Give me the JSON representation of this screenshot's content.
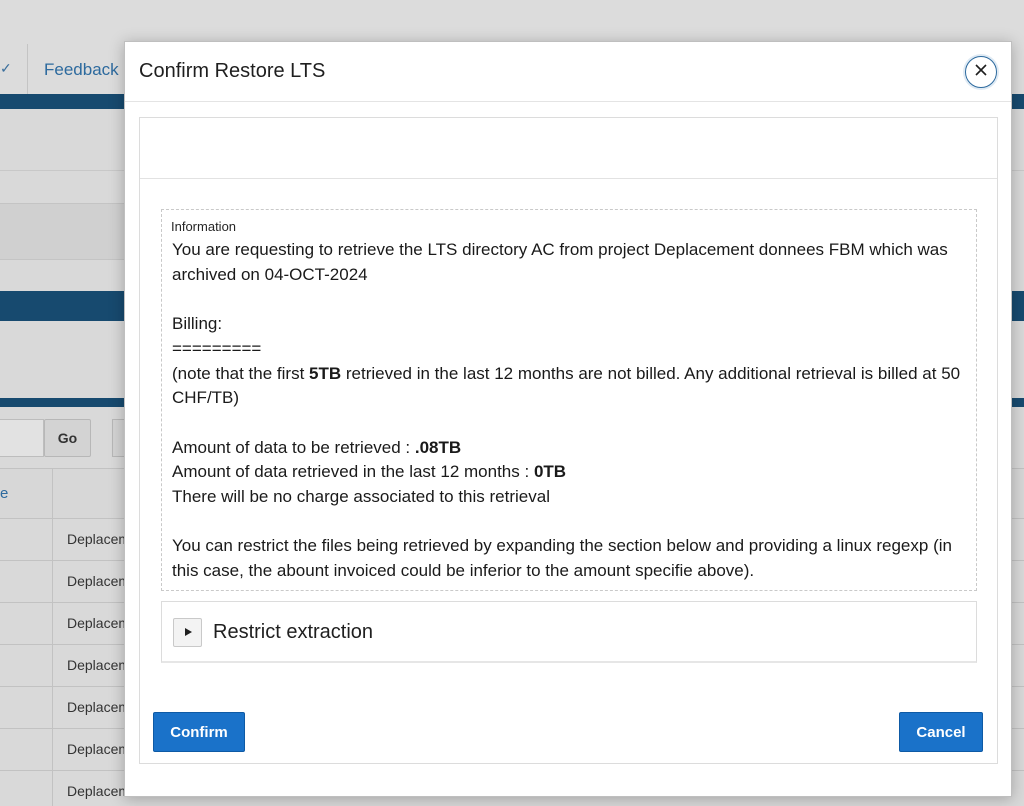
{
  "background": {
    "nav": {
      "feedback_label": "Feedback"
    },
    "search": {
      "go_label": "Go"
    },
    "table": {
      "header_first_col": "e",
      "rows": [
        "Deplacem",
        "Deplacem",
        "Deplacem",
        "Deplacem",
        "Deplacem",
        "Deplacem",
        "Deplacem"
      ]
    }
  },
  "dialog": {
    "title": "Confirm Restore LTS",
    "close_icon": "close-icon",
    "information": {
      "label": "Information",
      "request_text": "You are requesting to retrieve the LTS directory AC from project Deplacement donnees FBM which was archived on 04-OCT-2024",
      "billing_heading": "Billing:",
      "billing_rule": "=========",
      "note_prefix": "(note that the first ",
      "note_bold": "5TB",
      "note_suffix": " retrieved in the last 12 months are not billed. Any additional retrieval is billed at 50 CHF/TB)",
      "amount_label": "Amount of data to be retrieved : ",
      "amount_value": ".08TB",
      "retrieved_label": "Amount of data retrieved in the last 12 months : ",
      "retrieved_value": "0TB",
      "charge_text": "There will be no charge associated to this retrieval",
      "restrict_text": "You can restrict the files being retrieved by expanding the section below and providing a linux regexp (in this case, the abount invoiced could be inferior to the amount specifie above)."
    },
    "restrict_section": {
      "title": "Restrict extraction",
      "toggle_icon": "play-triangle-icon",
      "expanded": false
    },
    "buttons": {
      "confirm": "Confirm",
      "cancel": "Cancel"
    }
  },
  "colors": {
    "accent": "#1a72c9",
    "header_band": "#174a6f",
    "link": "#2d6a9e"
  }
}
